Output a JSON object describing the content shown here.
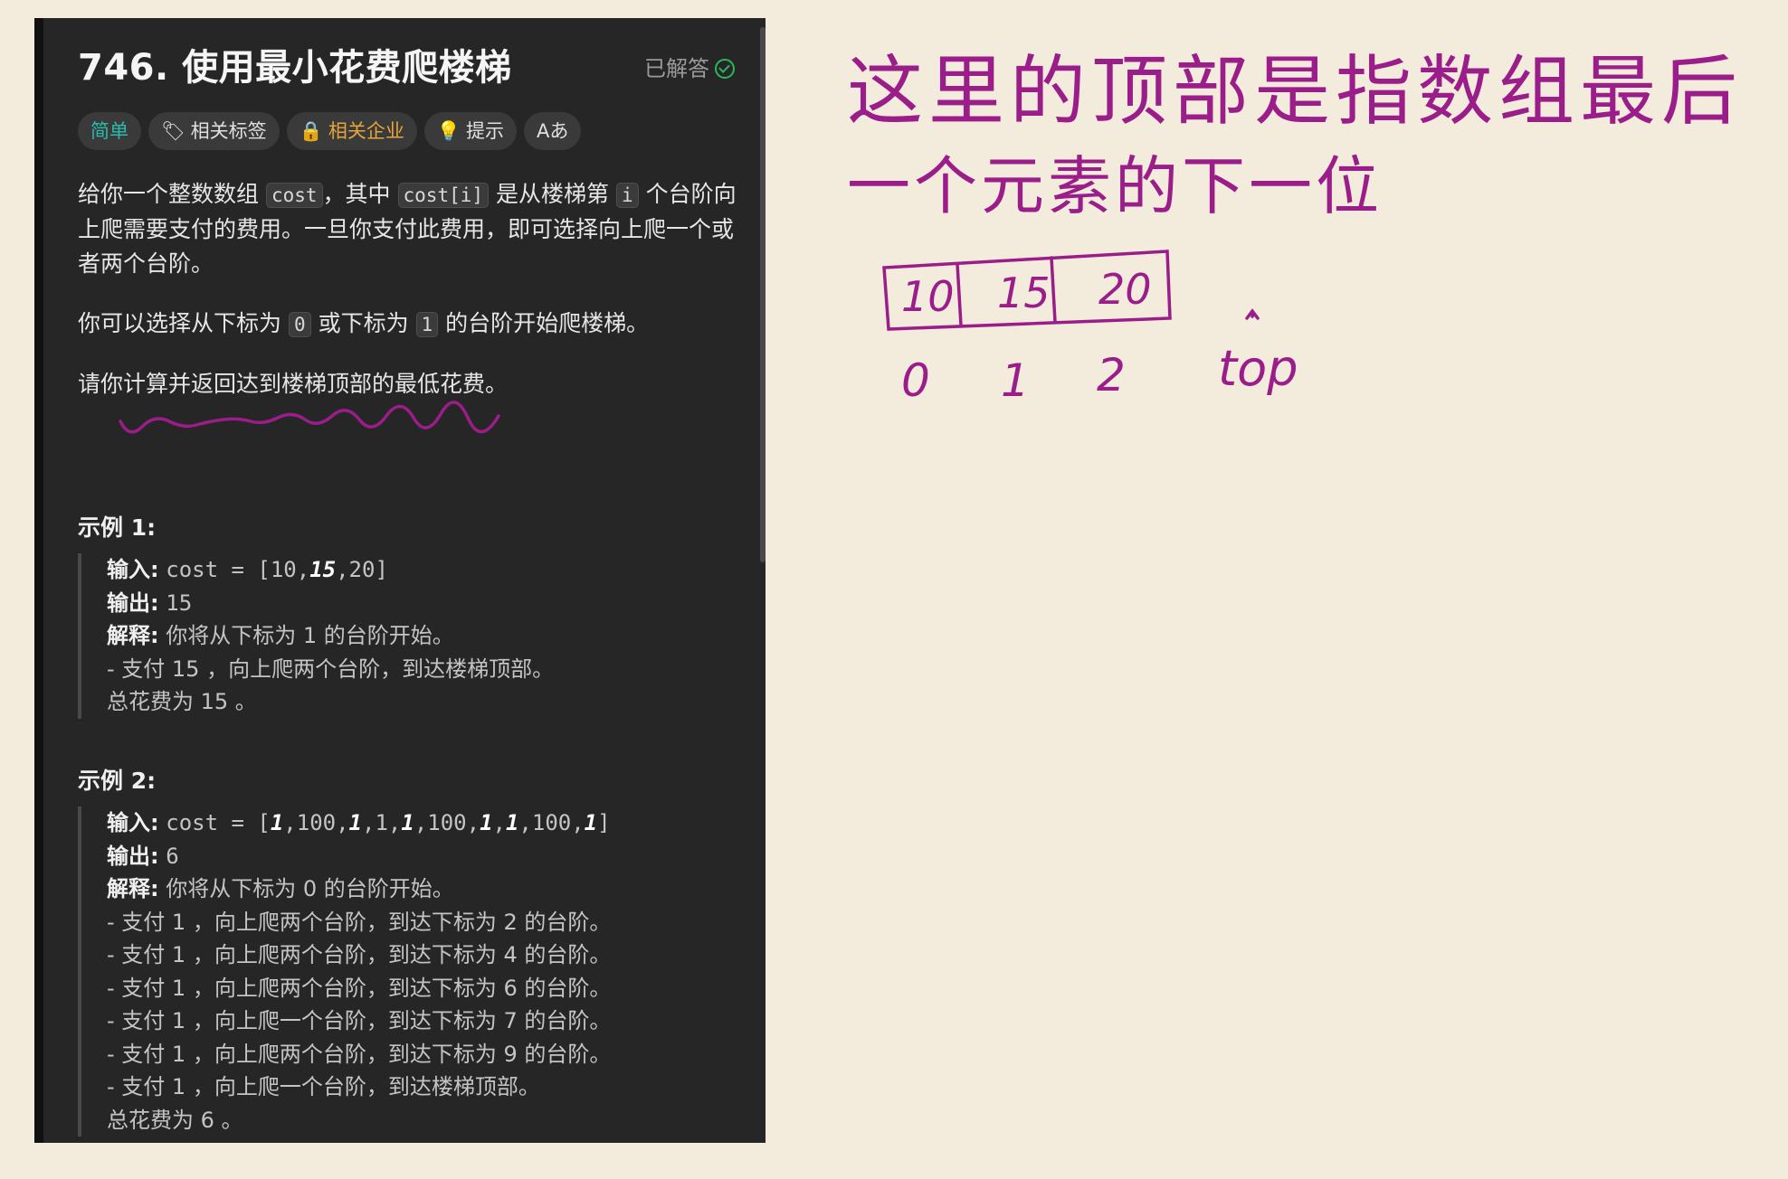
{
  "problem": {
    "title": "746. 使用最小花费爬楼梯",
    "status": "已解答",
    "tags": {
      "difficulty": "简单",
      "related_tags": "相关标签",
      "related_companies": "相关企业",
      "hint": "提示",
      "font": "Aあ"
    },
    "desc": {
      "p1_a": "给你一个整数数组",
      "p1_code1": "cost",
      "p1_b": "，其中",
      "p1_code2": "cost[i]",
      "p1_c": "是从楼梯第",
      "p1_code3": "i",
      "p1_d": "个台阶向上爬需要支付的费用。一旦你支付此费用，即可选择向上爬一个或者两个台阶。",
      "p2_a": "你可以选择从下标为",
      "p2_code1": "0",
      "p2_b": "或下标为",
      "p2_code2": "1",
      "p2_c": "的台阶开始爬楼梯。",
      "p3": "请你计算并返回达到楼梯顶部的最低花费。"
    },
    "examples": [
      {
        "title": "示例 1:",
        "input_label": "输入:",
        "input_prefix": "cost = [10,",
        "input_bold": "15",
        "input_suffix": ",20]",
        "output_label": "输出:",
        "output": "15",
        "explain_label": "解释:",
        "explain": "你将从下标为 1 的台阶开始。",
        "lines": [
          "- 支付 15 ，向上爬两个台阶，到达楼梯顶部。",
          "总花费为 15 。"
        ]
      },
      {
        "title": "示例 2:",
        "input_label": "输入:",
        "input_parts": [
          "cost = [",
          "1",
          ",100,",
          "1",
          ",1,",
          "1",
          ",100,",
          "1",
          ",",
          "1",
          ",100,",
          "1",
          "]"
        ],
        "output_label": "输出:",
        "output": "6",
        "explain_label": "解释:",
        "explain": "你将从下标为 0 的台阶开始。",
        "lines": [
          "- 支付 1 ，向上爬两个台阶，到达下标为 2 的台阶。",
          "- 支付 1 ，向上爬两个台阶，到达下标为 4 的台阶。",
          "- 支付 1 ，向上爬两个台阶，到达下标为 6 的台阶。",
          "- 支付 1 ，向上爬一个台阶，到达下标为 7 的台阶。",
          "- 支付 1 ，向上爬两个台阶，到达下标为 9 的台阶。",
          "- 支付 1 ，向上爬一个台阶，到达楼梯顶部。",
          "总花费为 6 。"
        ]
      }
    ]
  },
  "notes": {
    "line1": "这里的顶部是指数组最后",
    "line2": "一个元素的下一位",
    "array": [
      "10",
      "15",
      "20"
    ],
    "indices": [
      "0",
      "1",
      "2"
    ],
    "top_label": "top",
    "ink_color": "#9a1d8a"
  }
}
